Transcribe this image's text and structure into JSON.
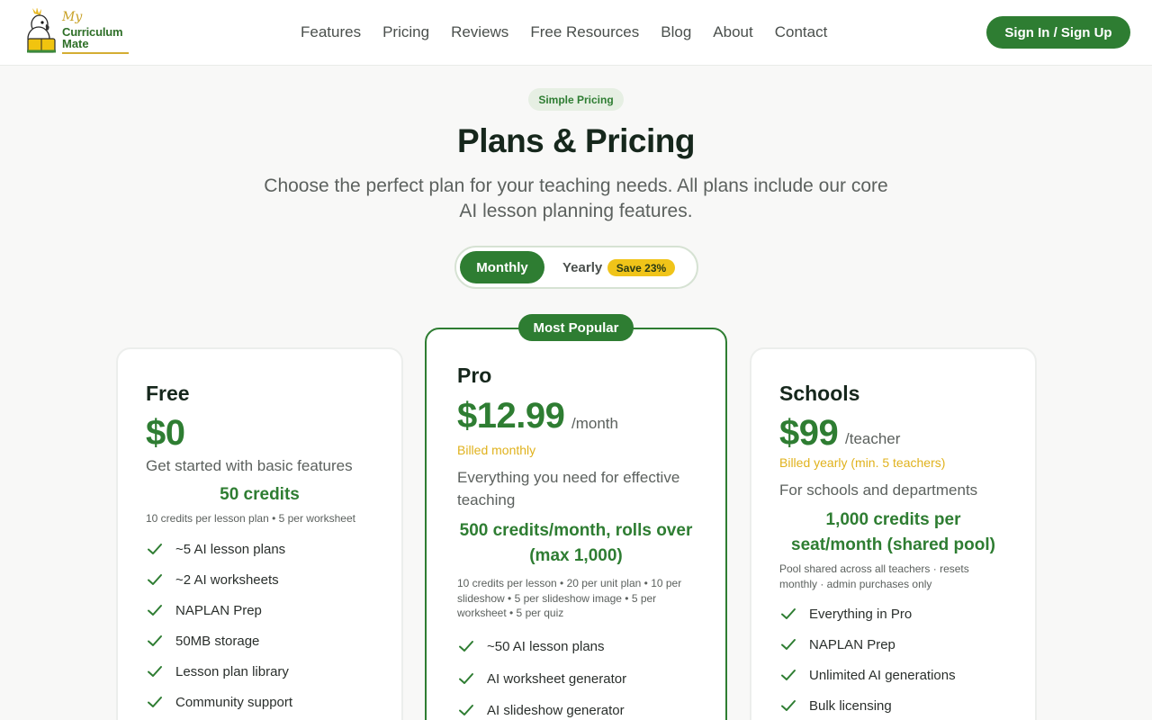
{
  "brand": {
    "logo_my": "My",
    "logo_line1": "Curriculum",
    "logo_line2": "Mate"
  },
  "nav": {
    "items": [
      "Features",
      "Pricing",
      "Reviews",
      "Free Resources",
      "Blog",
      "About",
      "Contact"
    ],
    "signin_label": "Sign In / Sign Up"
  },
  "hero": {
    "badge": "Simple Pricing",
    "title": "Plans & Pricing",
    "subtitle": "Choose the perfect plan for your teaching needs. All plans include our core AI lesson planning features."
  },
  "billing_toggle": {
    "monthly": "Monthly",
    "yearly": "Yearly",
    "save": "Save 23%",
    "selected": "Monthly"
  },
  "plans": {
    "free": {
      "name": "Free",
      "price": "$0",
      "description": "Get started with basic features",
      "credits": "50 credits",
      "credits_note": "10 credits per lesson plan • 5 per worksheet",
      "features": [
        "~5 AI lesson plans",
        "~2 AI worksheets",
        "NAPLAN Prep",
        "50MB storage",
        "Lesson plan library",
        "Community support"
      ]
    },
    "pro": {
      "badge": "Most Popular",
      "name": "Pro",
      "price": "$12.99",
      "period": "/month",
      "billed": "Billed monthly",
      "description": "Everything you need for effective teaching",
      "credits": "500 credits/month, rolls over (max 1,000)",
      "credits_note": "10 credits per lesson • 20 per unit plan • 10 per slideshow • 5 per slideshow image • 5 per worksheet • 5 per quiz",
      "features": [
        "~50 AI lesson plans",
        "AI worksheet generator",
        "AI slideshow generator"
      ]
    },
    "schools": {
      "name": "Schools",
      "price": "$99",
      "period": "/teacher",
      "billed": "Billed yearly (min. 5 teachers)",
      "description": "For schools and departments",
      "credits": "1,000 credits per seat/month (shared pool)",
      "credits_note": "Pool shared across all teachers · resets monthly · admin purchases only",
      "features": [
        "Everything in Pro",
        "NAPLAN Prep",
        "Unlimited AI generations",
        "Bulk licensing"
      ]
    }
  },
  "colors": {
    "primary_green": "#2e7d32",
    "accent_yellow": "#f0c419",
    "billed_text": "#e0b21d"
  },
  "icons": {
    "feature_check": "check-icon",
    "logo": "cockatoo-logo"
  }
}
